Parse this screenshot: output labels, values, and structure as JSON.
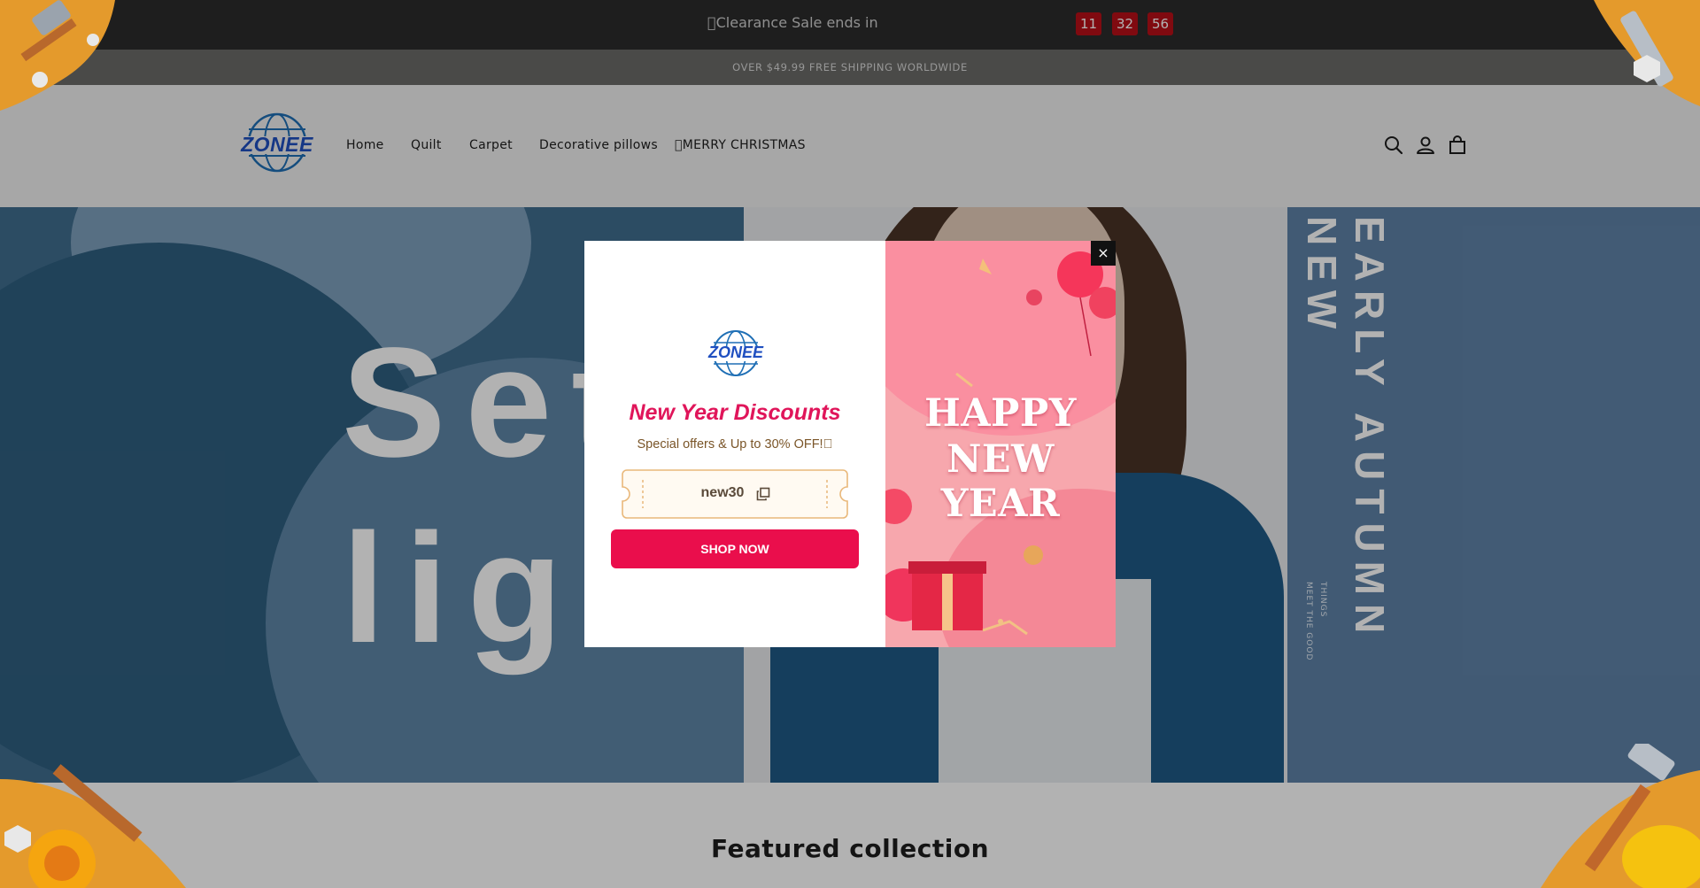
{
  "announcement": {
    "sale_text": "\u0000Clearance Sale ends in",
    "countdown": [
      "11",
      "32",
      "56"
    ],
    "shipping": "OVER $49.99 FREE SHIPPING WORLDWIDE"
  },
  "header": {
    "logo_text": "ZONEE",
    "nav": [
      "Home",
      "Quilt",
      "Carpet",
      "Decorative pillows",
      "\u0000MERRY CHRISTMAS"
    ],
    "icons": [
      "search-icon",
      "account-icon",
      "cart-icon"
    ]
  },
  "hero": {
    "big_line_1": "Set",
    "big_line_2": "ligh",
    "vertical_title": "EARLY AUTUMN NEW",
    "vertical_sub_1": "THINGS",
    "vertical_sub_2": "MEET THE GOOD"
  },
  "featured": {
    "title": "Featured collection"
  },
  "popup": {
    "logo_text": "ZONEE",
    "title": "New Year Discounts",
    "subtitle": "Special offers & Up to 30% OFF!\u0000",
    "coupon_code": "new30",
    "button": "SHOP NOW",
    "image_line_1": "HAPPY",
    "image_line_2": "NEW YEAR",
    "close": "×"
  },
  "colors": {
    "accent": "#ea0e4c",
    "title": "#e0155a",
    "countdown": "#b80f17",
    "topbar": "#2b2b2b"
  }
}
